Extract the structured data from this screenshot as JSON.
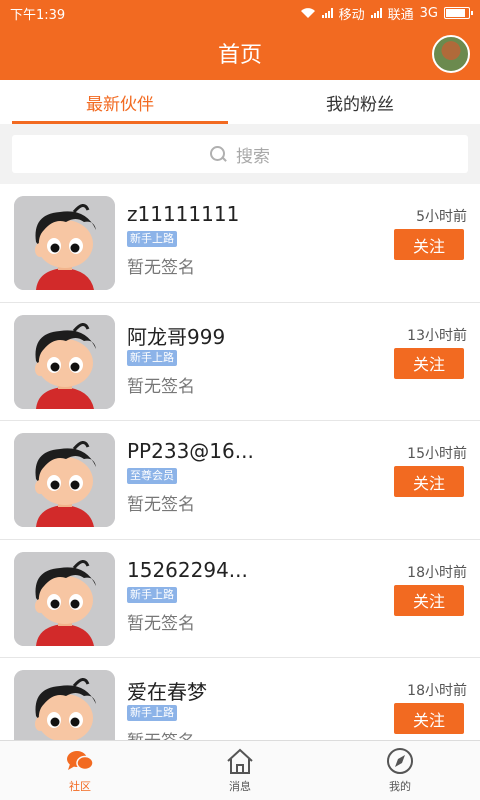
{
  "status_bar": {
    "time": "下午1:39",
    "carrier1": "移动",
    "carrier2": "联通",
    "network": "3G"
  },
  "header": {
    "title": "首页"
  },
  "tabs": [
    {
      "label": "最新伙伴",
      "active": true
    },
    {
      "label": "我的粉丝",
      "active": false
    }
  ],
  "search": {
    "placeholder": "搜索"
  },
  "users": [
    {
      "name": "z11111111",
      "badge": "新手上路",
      "signature": "暂无签名",
      "time": "5小时前",
      "follow_label": "关注"
    },
    {
      "name": "阿龙哥999",
      "badge": "新手上路",
      "signature": "暂无签名",
      "time": "13小时前",
      "follow_label": "关注"
    },
    {
      "name": "PP233@16...",
      "badge": "至尊会员",
      "signature": "暂无签名",
      "time": "15小时前",
      "follow_label": "关注"
    },
    {
      "name": "15262294...",
      "badge": "新手上路",
      "signature": "暂无签名",
      "time": "18小时前",
      "follow_label": "关注"
    },
    {
      "name": "爱在春梦",
      "badge": "新手上路",
      "signature": "暂无签名",
      "time": "18小时前",
      "follow_label": "关注"
    }
  ],
  "bottom_nav": [
    {
      "label": "社区",
      "icon": "chat-bubbles-icon",
      "active": true
    },
    {
      "label": "消息",
      "icon": "home-icon",
      "active": false
    },
    {
      "label": "我的",
      "icon": "compass-icon",
      "active": false
    }
  ],
  "colors": {
    "primary": "#f26a21",
    "badge": "#8cb3e8"
  }
}
